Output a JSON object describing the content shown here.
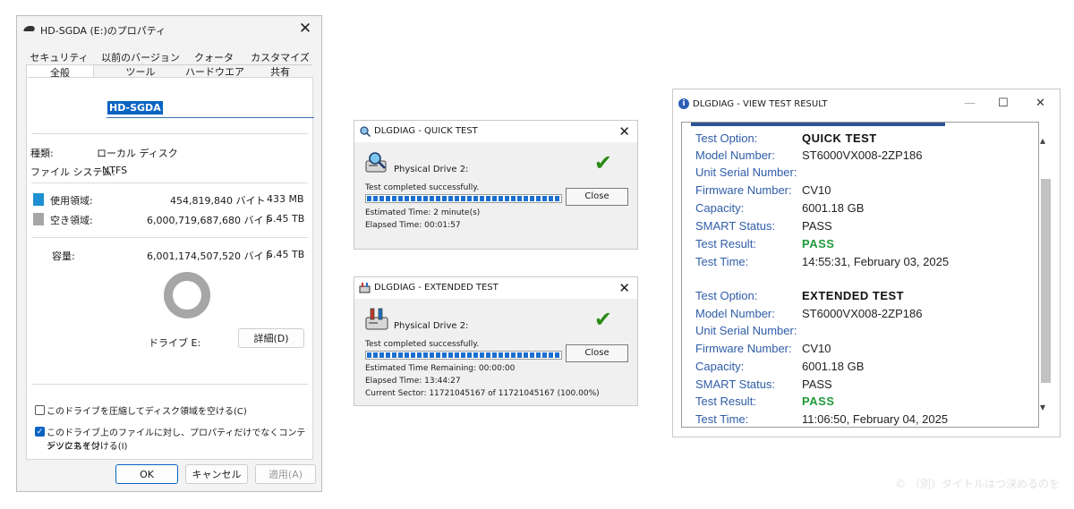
{
  "props": {
    "title": "HD-SGDA (E:)のプロパティ",
    "tabs_row1": [
      "セキュリティ",
      "以前のバージョン",
      "クォータ",
      "カスタマイズ"
    ],
    "tabs_row2": [
      "全般",
      "ツール",
      "ハードウエア",
      "共有"
    ],
    "name_value": "HD-SGDA",
    "type_label": "種類:",
    "type_value": "ローカル ディスク",
    "fs_label": "ファイル システム:",
    "fs_value": "NTFS",
    "used_label": "使用領域:",
    "used_bytes": "454,819,840 バイト",
    "used_size": "433 MB",
    "free_label": "空き領域:",
    "free_bytes": "6,000,719,687,680 バイト",
    "free_size": "5.45 TB",
    "capacity_label": "容量:",
    "capacity_bytes": "6,001,174,507,520 バイト",
    "capacity_size": "5.45 TB",
    "drive_label": "ドライブ E:",
    "details_button": "詳細(D)",
    "compress_label": "このドライブを圧縮してディスク領域を空ける(C)",
    "compress_checked": false,
    "index_label_line1": "このドライブ上のファイルに対し、プロパティだけでなくコンテンツにもイン",
    "index_label_line2": "デックスを付ける(I)",
    "index_checked": true,
    "ok_button": "OK",
    "cancel_button": "キャンセル",
    "apply_button": "適用(A)",
    "colors": {
      "used": "#1e90d2",
      "free": "#a6a6a6"
    }
  },
  "quick_test": {
    "title": "DLGDIAG - QUICK TEST",
    "drive": "Physical Drive 2:",
    "status": "Test completed successfully.",
    "estimated": "Estimated Time: 2 minute(s)",
    "elapsed": "Elapsed Time: 00:01:57",
    "close_button": "Close",
    "progress": 1.0
  },
  "extended_test": {
    "title": "DLGDIAG - EXTENDED TEST",
    "drive": "Physical Drive 2:",
    "status": "Test completed successfully.",
    "estimated": "Estimated Time Remaining: 00:00:00",
    "elapsed": "Elapsed Time: 13:44:27",
    "sector": "Current Sector: 11721045167 of 11721045167 (100.00%)",
    "close_button": "Close",
    "progress": 1.0
  },
  "view_result": {
    "title": "DLGDIAG - VIEW TEST RESULT",
    "labels": {
      "option": "Test Option:",
      "model": "Model Number:",
      "serial": "Unit Serial Number:",
      "firmware": "Firmware Number:",
      "capacity": "Capacity:",
      "smart": "SMART Status:",
      "result": "Test Result:",
      "time": "Test Time:"
    },
    "records": [
      {
        "option": "QUICK TEST",
        "model": "ST6000VX008-2ZP186",
        "serial": "",
        "firmware": "CV10",
        "capacity": "6001.18 GB",
        "smart": "PASS",
        "result": "PASS",
        "time": "14:55:31, February 03, 2025"
      },
      {
        "option": "EXTENDED TEST",
        "model": "ST6000VX008-2ZP186",
        "serial": "",
        "firmware": "CV10",
        "capacity": "6001.18 GB",
        "smart": "PASS",
        "result": "PASS",
        "time": "11:06:50, February 04, 2025"
      }
    ]
  },
  "watermark": "© （別）タイトルはつ決めるのを"
}
